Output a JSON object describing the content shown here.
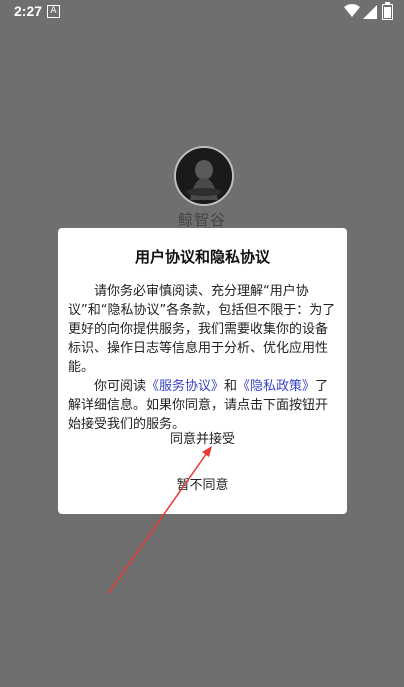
{
  "status_bar": {
    "time": "2:27",
    "notification_letter": "A"
  },
  "app": {
    "name": "鲸智谷"
  },
  "dialog": {
    "title": "用户协议和隐私协议",
    "paragraph1": "请你务必审慎阅读、充分理解“用户协议”和“隐私协议”各条款，包括但不限于：为了更好的向你提供服务，我们需要收集你的设备标识、操作日志等信息用于分析、优化应用性能。",
    "paragraph2_prefix": "你可阅读",
    "service_link": "《服务协议》",
    "and_text": "和",
    "privacy_link": "《隐私政策》",
    "paragraph2_suffix": "了解详细信息。如果你同意，请点击下面按钮开始接受我们的服务。",
    "agree_label": "同意并接受",
    "disagree_label": "暂不同意"
  },
  "colors": {
    "overlay": "#6f6f6f",
    "link": "#3a44c8",
    "annotation_arrow": "#e53935"
  }
}
